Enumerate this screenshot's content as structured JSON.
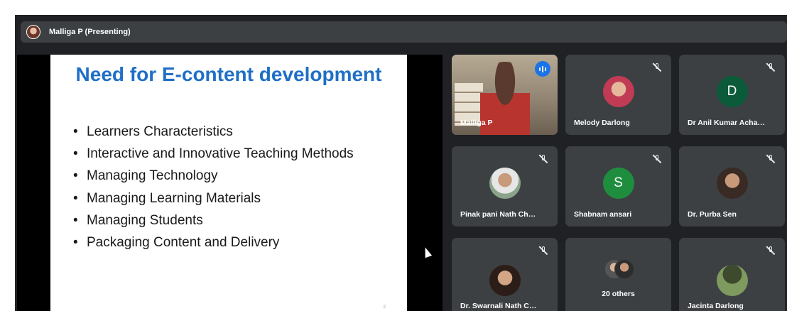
{
  "topbar": {
    "title": "Malliga P (Presenting)"
  },
  "slide": {
    "title": "Need for E-content development",
    "bullets": [
      "Learners Characteristics",
      "Interactive and Innovative Teaching Methods",
      "Managing Technology",
      "Managing Learning Materials",
      "Managing Students",
      "Packaging Content and Delivery"
    ],
    "page": "2"
  },
  "participants": [
    {
      "name": "Malliga P",
      "type": "video",
      "speaking": true
    },
    {
      "name": "Melody Darlong",
      "type": "photo",
      "muted": true,
      "color": "#c9a38a"
    },
    {
      "name": "Dr Anil Kumar Acha…",
      "type": "letter",
      "letter": "D",
      "muted": true,
      "color": "#0b5a3a"
    },
    {
      "name": "Pinak pani Nath Ch…",
      "type": "photo",
      "muted": true,
      "color": "#9aa79a"
    },
    {
      "name": "Shabnam ansari",
      "type": "letter",
      "letter": "S",
      "muted": true,
      "color": "#1e8e3e"
    },
    {
      "name": "Dr. Purba Sen",
      "type": "photo",
      "muted": true,
      "color": "#b58f74"
    },
    {
      "name": "Dr. Swarnali Nath C…",
      "type": "photo",
      "muted": true,
      "color": "#c8a28c"
    },
    {
      "name": "20 others",
      "type": "others"
    },
    {
      "name": "Jacinta Darlong",
      "type": "photo",
      "muted": true,
      "color": "#6e8a55"
    }
  ]
}
